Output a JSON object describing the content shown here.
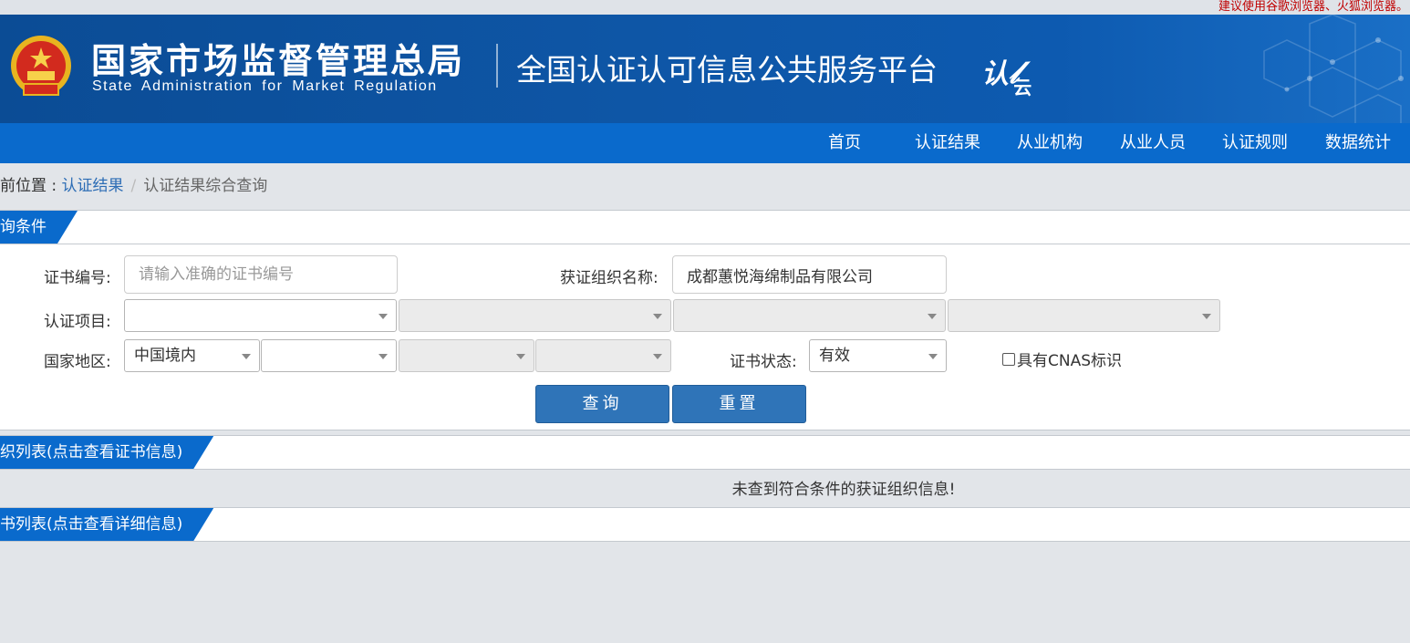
{
  "topbar": {
    "notice": "建议使用谷歌浏览器、火狐浏览器。"
  },
  "header": {
    "org_name_cn": "国家市场监督管理总局",
    "org_name_en": "State Administration  for  Market Regulation",
    "platform_title": "全国认证认可信息公共服务平台",
    "logo_mark": "认",
    "logo_sub": "云"
  },
  "nav": {
    "items": [
      {
        "label": "首页"
      },
      {
        "label": "认证结果"
      },
      {
        "label": "从业机构"
      },
      {
        "label": "从业人员"
      },
      {
        "label": "认证规则"
      },
      {
        "label": "数据统计"
      }
    ]
  },
  "breadcrumb": {
    "prefix": "前位置 : ",
    "link": "认证结果",
    "separator": "/",
    "current": "认证结果综合查询"
  },
  "query_panel": {
    "title": "询条件",
    "cert_no_label": "证书编号:",
    "cert_no_placeholder": "请输入准确的证书编号",
    "cert_no_value": "",
    "org_name_label": "获证组织名称:",
    "org_name_value": "成都蕙悦海绵制品有限公司",
    "project_label": "认证项目:",
    "project_selects": [
      "",
      "",
      "",
      ""
    ],
    "region_label": "国家地区:",
    "region_selects": [
      "中国境内",
      "",
      "",
      ""
    ],
    "status_label": "证书状态:",
    "status_value": "有效",
    "cnas_label": "具有CNAS标识",
    "query_button": "查询",
    "reset_button": "重置"
  },
  "org_panel": {
    "title": "织列表(点击查看证书信息)",
    "empty_message": "未查到符合条件的获证组织信息!"
  },
  "cert_panel": {
    "title": "书列表(点击查看详细信息)"
  },
  "colors": {
    "banner": "#0e56a6",
    "nav": "#0a6acc",
    "button": "#2f74b8",
    "notice": "#c00000",
    "link": "#2d6db5"
  }
}
